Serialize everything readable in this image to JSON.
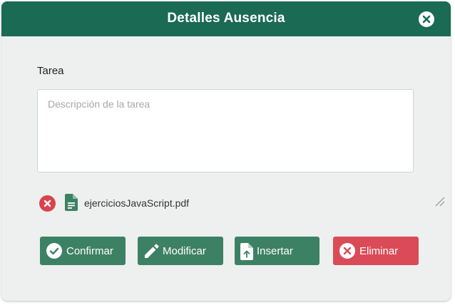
{
  "dialog": {
    "title": "Detalles Ausencia",
    "close_icon": "close-circle-icon"
  },
  "task": {
    "label": "Tarea",
    "placeholder": "Descripción de la tarea",
    "value": ""
  },
  "attachment": {
    "file_name": "ejerciciosJavaScript.pdf",
    "remove_icon": "remove-circle-icon",
    "file_icon": "document-icon"
  },
  "actions": {
    "confirm": "Confirmar",
    "modify": "Modificar",
    "insert": "Insertar",
    "delete": "Eliminar"
  },
  "colors": {
    "header": "#1a6a54",
    "primary_button": "#3d8165",
    "danger_button": "#da4b57",
    "background": "#edf0ef"
  }
}
